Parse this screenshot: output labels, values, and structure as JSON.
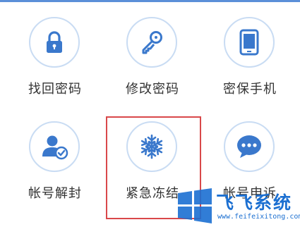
{
  "theme": {
    "accent": "#5b8fd8",
    "icon_color": "#3a78cc",
    "ring_color": "#c9dcf3",
    "highlight_color": "#d9484a"
  },
  "grid": {
    "items": [
      {
        "icon": "lock-icon",
        "label": "找回密码"
      },
      {
        "icon": "key-icon",
        "label": "修改密码"
      },
      {
        "icon": "phone-icon",
        "label": "密保手机"
      },
      {
        "icon": "user-check-icon",
        "label": "帐号解封"
      },
      {
        "icon": "snowflake-icon",
        "label": "紧急冻结"
      },
      {
        "icon": "chat-icon",
        "label": "帐号申诉"
      }
    ]
  },
  "highlighted_item": "紧急冻结",
  "watermark": {
    "title": "飞飞系统",
    "url": "www.feifeixitong.com"
  }
}
